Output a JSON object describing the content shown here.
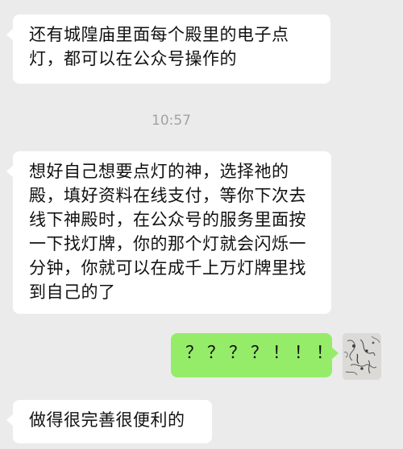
{
  "messages": [
    {
      "id": "msg1",
      "direction": "incoming",
      "text": "还有城隍庙里面每个殿里的电子点灯，都可以在公众号操作的"
    },
    {
      "id": "msg2",
      "direction": "incoming",
      "text": "想好自己想要点灯的神，选择祂的殿，填好资料在线支付，等你下次去线下神殿时，在公众号的服务里面按一下找灯牌，你的那个灯就会闪烁一分钟，你就可以在成千上万灯牌里找到自己的了"
    },
    {
      "id": "msg3",
      "direction": "outgoing",
      "text": "？？？？！！！"
    },
    {
      "id": "msg4",
      "direction": "incoming",
      "text": "做得很完善很便利的"
    }
  ],
  "timestamp": "10:57",
  "colors": {
    "background": "#ebebeb",
    "incoming_bubble": "#ffffff",
    "outgoing_bubble": "#95ec69",
    "timestamp_text": "#a3a3a3"
  },
  "avatar": {
    "icon": "sketch-avatar-icon"
  }
}
